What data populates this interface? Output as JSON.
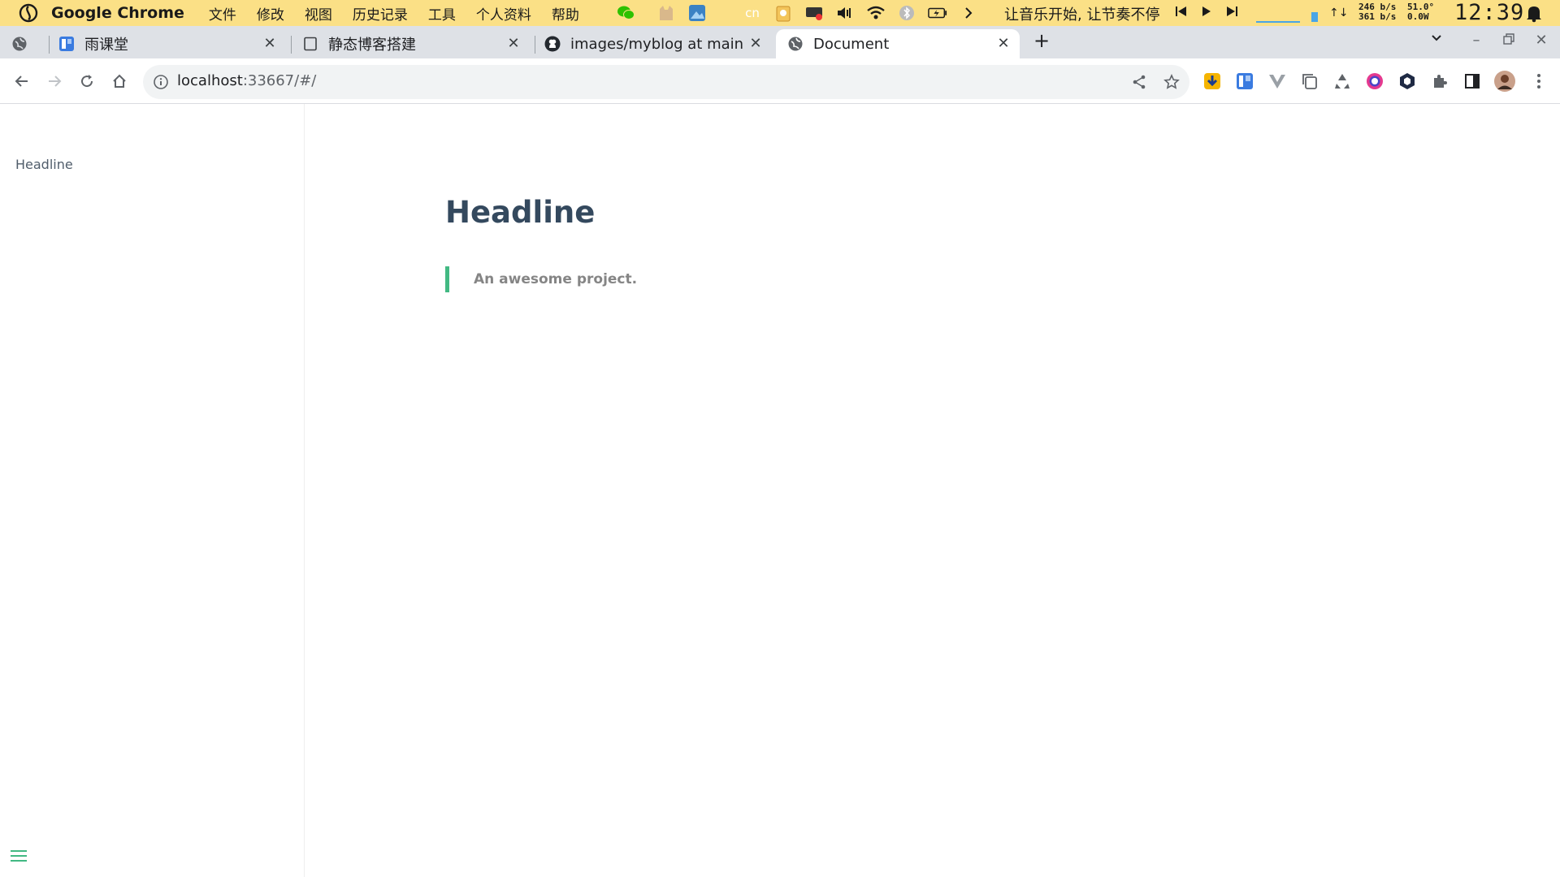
{
  "menubar": {
    "app_name": "Google Chrome",
    "menus": [
      "文件",
      "修改",
      "视图",
      "历史记录",
      "工具",
      "个人资料",
      "帮助"
    ],
    "tray_cn": "cn",
    "music_text": "让音乐开始, 让节奏不停",
    "net_up": "246 b/s",
    "net_down": "361 b/s",
    "temp": "51.0°",
    "power": "0.0W",
    "clock": "12:39"
  },
  "tabs": [
    {
      "title": "雨课堂",
      "icon": "yuketang-icon"
    },
    {
      "title": "静态博客搭建",
      "icon": "page-icon"
    },
    {
      "title": "images/myblog at main",
      "icon": "github-icon",
      "suffix": "·"
    },
    {
      "title": "Document",
      "icon": "globe-icon",
      "active": true
    }
  ],
  "toolbar": {
    "url_host": "localhost",
    "url_rest": ":33667/#/"
  },
  "page": {
    "sidebar_link": "Headline",
    "heading": "Headline",
    "quote": "An awesome project."
  },
  "colors": {
    "menubar_bg": "#fbe086",
    "accent": "#42b983",
    "heading": "#34495e"
  }
}
